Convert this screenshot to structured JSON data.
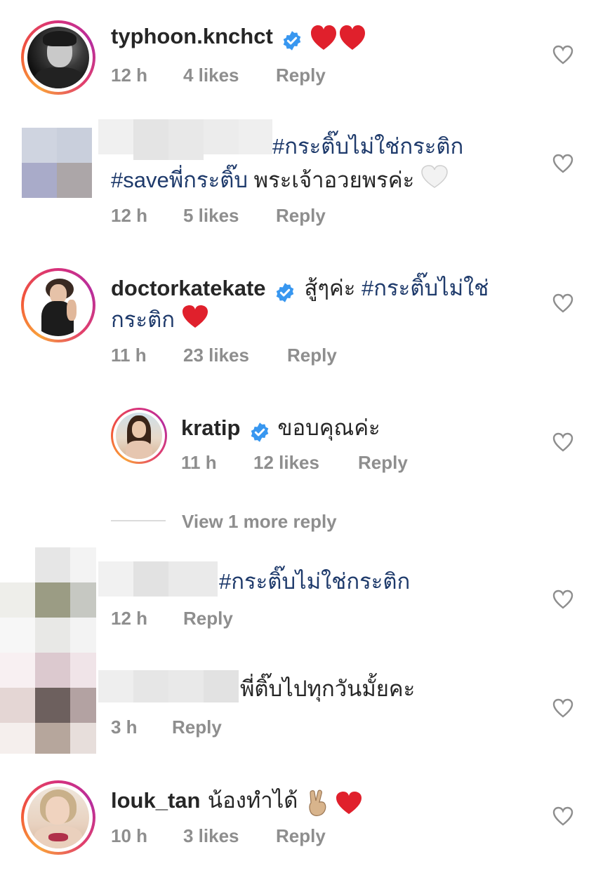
{
  "comments": [
    {
      "username": "typhoon.knchct",
      "text": "",
      "emoji": "❤❤",
      "time": "12 h",
      "likes": "4 likes",
      "reply": "Reply"
    },
    {
      "username": "",
      "text_line1": "#กระติ๊บไม่ใช่กระติก",
      "text_line2_tag": "#saveพี่กระติ๊บ",
      "text_line2": " พระเจ้าอวยพรค่ะ",
      "emoji": "🤍",
      "time": "12 h",
      "likes": "5 likes",
      "reply": "Reply"
    },
    {
      "username": "doctorkatekate",
      "text_plain": "สู้ๆค่ะ ",
      "text_tag1": "#กระติ๊บไม่ใช่",
      "text_tag2": "กระติก",
      "emoji": "❤",
      "time": "11 h",
      "likes": "23 likes",
      "reply": "Reply"
    },
    {
      "username": "kratip",
      "text": "ขอบคุณค่ะ",
      "time": "11 h",
      "likes": "12 likes",
      "reply": "Reply"
    },
    {
      "username": "",
      "text": "#กระติ๊บไม่ใช่กระติก",
      "time": "12 h",
      "reply": "Reply"
    },
    {
      "username": "",
      "text": "พี่ติ๊บไปทุกวันมั้ยคะ",
      "time": "3 h",
      "reply": "Reply"
    },
    {
      "username": "louk_tan",
      "text": "น้องทำได้",
      "emoji": "✌❤",
      "time": "10 h",
      "likes": "3 likes",
      "reply": "Reply"
    }
  ],
  "view_more": "View 1 more reply",
  "colors": {
    "meta": "#8e8e8e",
    "hashtag": "#1e3a6b",
    "verified": "#3897f0",
    "heart_red": "#e0202c"
  }
}
